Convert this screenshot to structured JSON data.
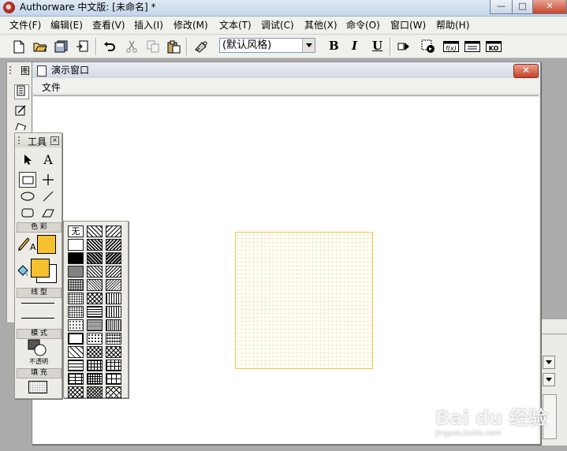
{
  "app": {
    "title": "Authorware 中文版: [未命名] *",
    "window_controls": {
      "minimize": "—",
      "maximize": "□",
      "close": "✕"
    }
  },
  "menubar": {
    "items": [
      "文件(F)",
      "编辑(E)",
      "查看(V)",
      "插入(I)",
      "修改(M)",
      "文本(T)",
      "调试(C)",
      "其他(X)",
      "命令(O)",
      "窗口(W)",
      "帮助(H)"
    ]
  },
  "toolbar": {
    "style_select": "(默认风格)",
    "bold": "B",
    "italic": "I",
    "underline": "U",
    "icons": [
      "new-file-icon",
      "open-folder-icon",
      "save-all-icon",
      "import-icon",
      "undo-icon",
      "cut-icon",
      "copy-icon",
      "paste-icon",
      "find-icon",
      "run-icon",
      "control-panel-icon",
      "function-icon",
      "variable-icon",
      "knowledge-object-icon"
    ],
    "function_label": "f(x)",
    "ko_label": "KO"
  },
  "left_panel": {
    "title": "图"
  },
  "presentation_window": {
    "title": "演示窗口",
    "close": "✕",
    "menu": [
      "文件"
    ]
  },
  "tools_palette": {
    "title": "工具",
    "close": "×",
    "text_tool": "A",
    "color_section": "色 彩",
    "line_color_letter": "A",
    "line_section": "线 型",
    "mode_section": "模 式",
    "mode_value": "不透明",
    "fill_section": "填 充",
    "fill_color": "#f5c12e",
    "line_color": "#f5c12e"
  },
  "pattern_palette": {
    "none_label": "无"
  },
  "watermark": {
    "logo": "Bai du 经验",
    "url": "jingyan.baidu.com"
  }
}
